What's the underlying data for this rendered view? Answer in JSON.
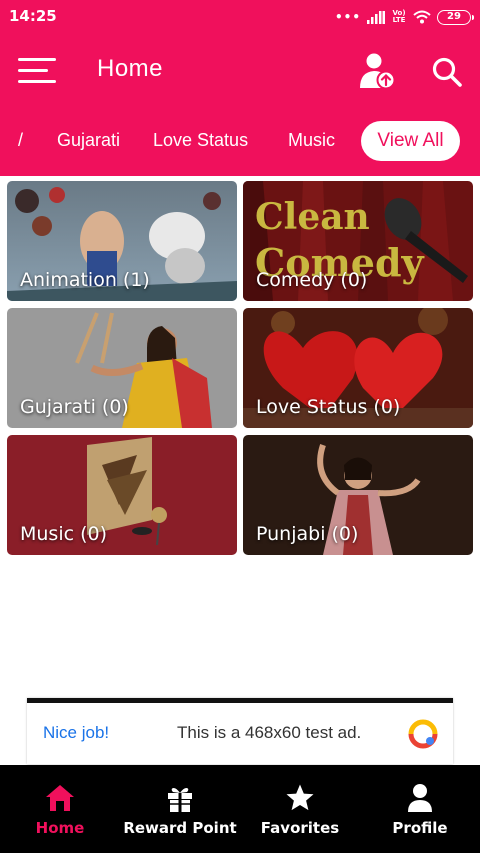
{
  "status_bar": {
    "time": "14:25",
    "dots": "•••",
    "network": "Vo) LTE",
    "battery": "29"
  },
  "app_bar": {
    "title": "Home"
  },
  "tabs": {
    "partial": "/",
    "items": [
      "Gujarati",
      "Love Status",
      "Music"
    ],
    "view_all_label": "View All"
  },
  "categories": [
    {
      "label": "Animation (1)"
    },
    {
      "label": "Comedy (0)",
      "art_text_1": "Clean",
      "art_text_2": "Comedy"
    },
    {
      "label": "Gujarati (0)"
    },
    {
      "label": "Love Status (0)"
    },
    {
      "label": "Music (0)"
    },
    {
      "label": "Punjabi (0)"
    }
  ],
  "ad": {
    "cta": "Nice job!",
    "text": "This is a 468x60 test ad."
  },
  "bottom_nav": [
    {
      "label": "Home",
      "icon": "home-icon",
      "active": true
    },
    {
      "label": "Reward Point",
      "icon": "gift-icon",
      "active": false
    },
    {
      "label": "Favorites",
      "icon": "star-icon",
      "active": false
    },
    {
      "label": "Profile",
      "icon": "person-icon",
      "active": false
    }
  ],
  "colors": {
    "primary": "#f0105c",
    "nav_bg": "#000000",
    "ad_link": "#1a73e8"
  }
}
